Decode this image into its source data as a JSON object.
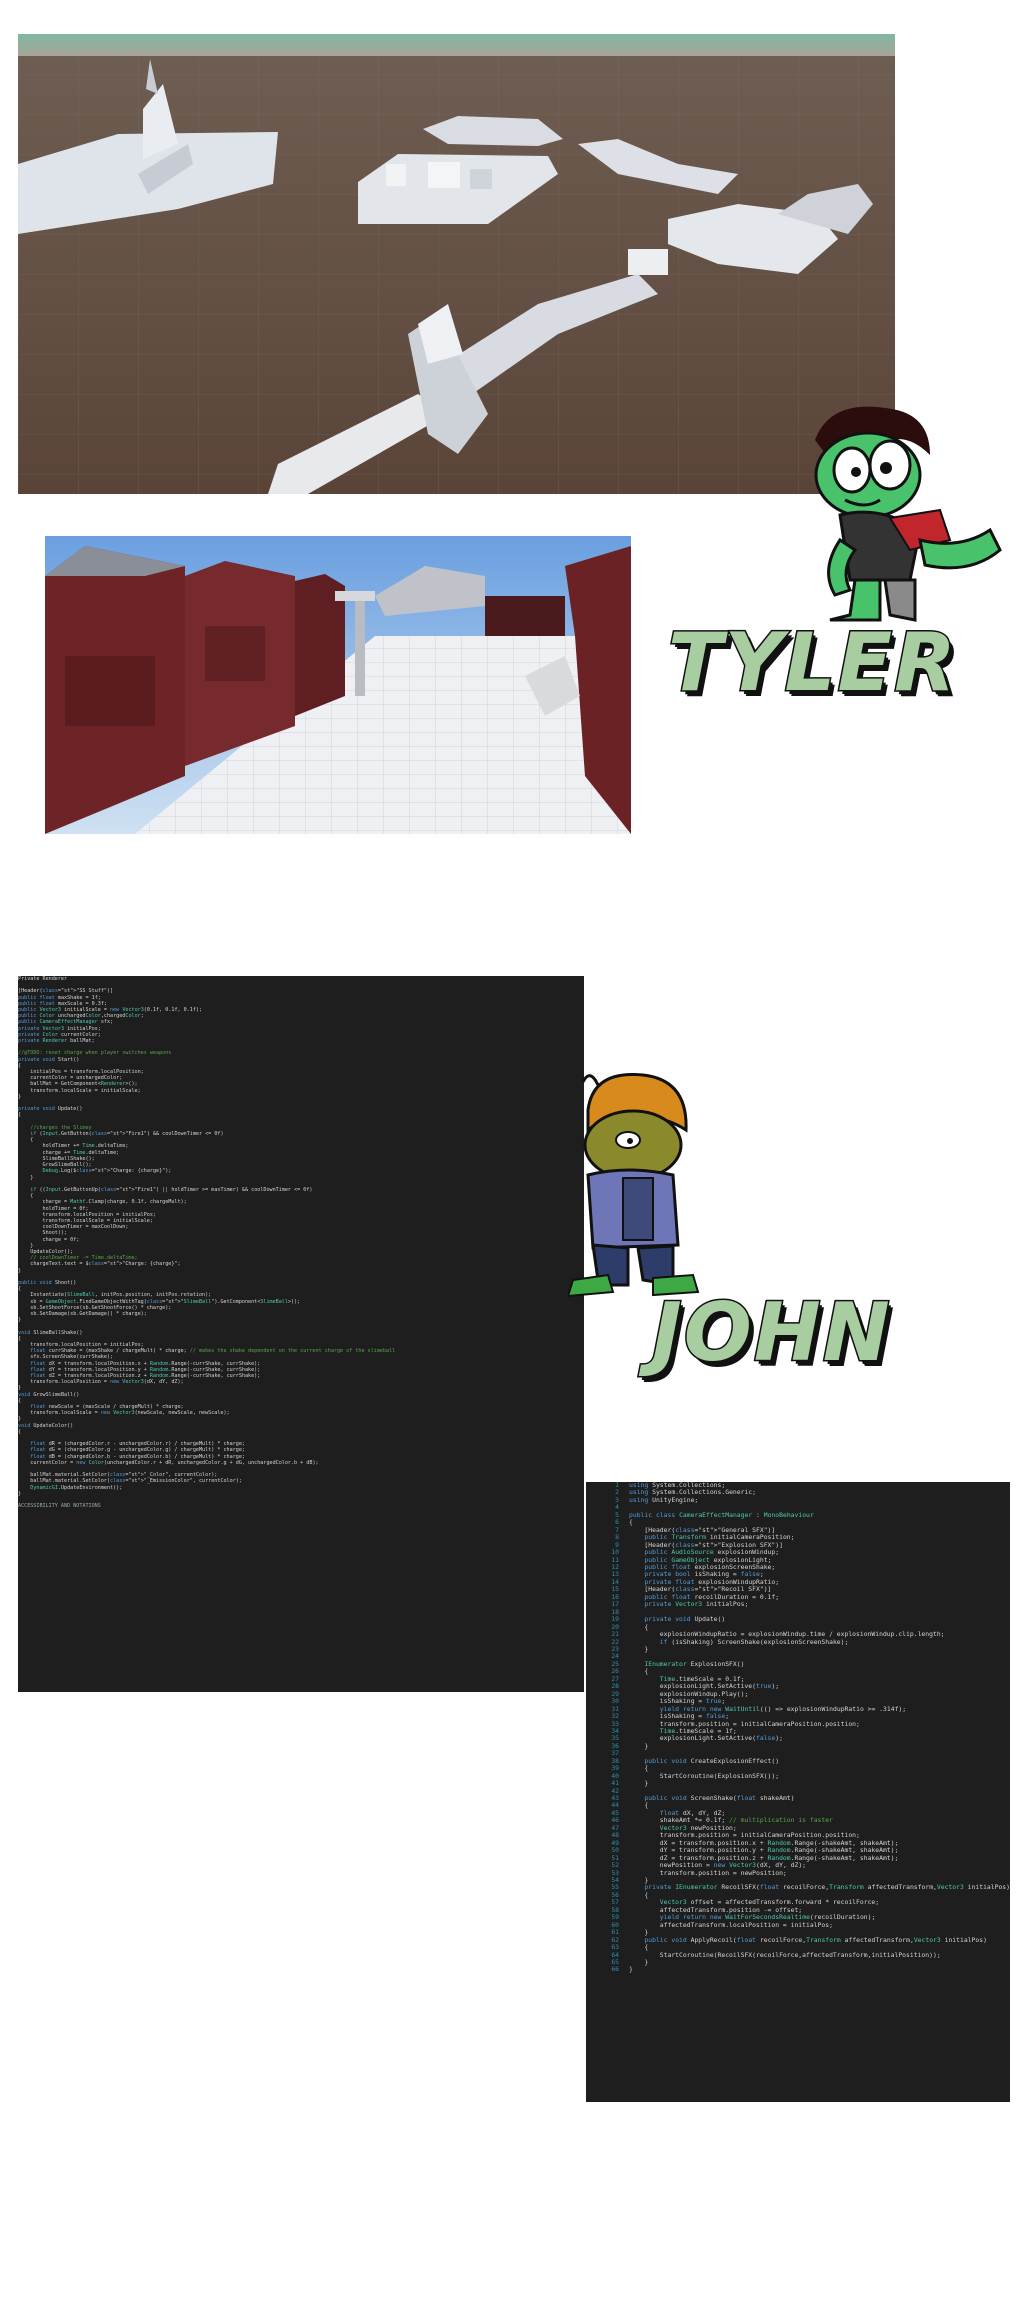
{
  "characters": [
    {
      "name": "TYLER"
    },
    {
      "name": "JOHN"
    }
  ],
  "code_left": {
    "top_fragment": "Private Renderer ",
    "lines": [
      "[Header(\"SS Stuff\")]",
      "public float maxShake = 1f;",
      "public float maxScale = 0.3f;",
      "public Vector3 initialScale = new Vector3(0.1f, 0.1f, 0.1f);",
      "public Color uncharged​Color,charged​Color;",
      "public CameraEffectManager sfx;",
      "private Vector3 initialPos;",
      "private Color currentColor;",
      "private Renderer ballMat;",
      "",
      "//@TODO: reset charge when player switches weapons",
      "private void Start()",
      "{",
      "    initialPos = transform.localPosition;",
      "    currentColor = unchargedColor;",
      "    ballMat = GetComponent<Renderer>();",
      "    transform.localScale = initialScale;",
      "}",
      "",
      "private void Update()",
      "{",
      "",
      "    //charges the Slimey",
      "    if (Input.GetButton(\"Fire1\") && coolDownTimer <= 0f)",
      "    {",
      "        holdTimer += Time.deltaTime;",
      "        charge += Time.deltaTime;",
      "        SlimeBallShake();",
      "        GrowSlimeBall();",
      "        Debug.Log($\"Charge: {charge}\");",
      "    }",
      "",
      "    if ((Input.GetButtonUp(\"Fire1\") || holdTimer >= maxTimer) && coolDownTimer <= 0f)",
      "    {",
      "        charge = Mathf.Clamp(charge, 0.1f, chargeMult);",
      "        holdTimer = 0f;",
      "        transform.localPosition = initialPos;",
      "        transform.localScale = initialScale;",
      "        coolDownTimer = maxCoolDown;",
      "        Shoot();",
      "        charge = 0f;",
      "    }",
      "    UpdateColor();",
      "    // coolDownTimer -= Time.deltaTime;",
      "    chargeText.text = $\"Charge: {charge}\";",
      "}",
      "",
      "public void Shoot()",
      "{",
      "    Instantiate(SlimeBall, initPos.position, initPos.rotation);",
      "    sb = GameObject.FindGameObjectWithTag(\"SlimeBall\").GetComponent<SlimeBall>();",
      "    sb.SetShootForce(sb.GetShootForce() * charge);",
      "    sb.SetDamage(sb.GetDamage() * charge);",
      "}",
      "",
      "void SlimeBallShake()",
      "{",
      "    transform.localPosition = initialPos;",
      "    float currShake = (maxShake / chargeMult) * charge; // makes the shake dependent on the current charge of the slimeball",
      "    sfx.ScreenShake(currShake);",
      "    float dX = transform.localPosition.x + Random.Range(-currShake, currShake);",
      "    float dY = transform.localPosition.y + Random.Range(-currShake, currShake);",
      "    float dZ = transform.localPosition.z + Random.Range(-currShake, currShake);",
      "    transform.localPosition = new Vector3(dX, dY, dZ);",
      "}",
      "void GrowSlimeBall()",
      "{",
      "    float newScale = (maxScale / chargeMult) * charge;",
      "    transform.localScale = new Vector3(newScale, newScale, newScale);",
      "}",
      "void UpdateColor()",
      "{",
      "",
      "    float dR = (chargedColor.r - unchargedColor.r) / chargeMult) * charge;",
      "    float dG = (chargedColor.g - unchargedColor.g) / chargeMult) * charge;",
      "    float dB = (chargedColor.b - unchargedColor.b) / chargeMult) * charge;",
      "    currentColor = new Color(unchargedColor.r + dR, unchargedColor.g + dG, unchargedColor.b + dB);",
      "",
      "    ballMat.material.SetColor(\"_Color\", currentColor);",
      "    ballMat.material.SetColor(\"_EmissionColor\", currentColor);",
      "    DynamicGI.UpdateEnvironment();",
      "}"
    ],
    "footer": "ACCESSIBILITY AND NOTATIONS"
  },
  "code_right": {
    "lines": [
      "using System.Collections;",
      "using System.Collections.Generic;",
      "using UnityEngine;",
      "",
      "public class CameraEffectManager : MonoBehaviour",
      "{",
      "    [Header(\"General SFX\")]",
      "    public Transform initialCameraPosition;",
      "    [Header(\"Explosion SFX\")]",
      "    public AudioSource explosionWindup;",
      "    public GameObject explosionLight;",
      "    public float explosionScreenShake;",
      "    private bool isShaking = false;",
      "    private float explosionWindupRatio;",
      "    [Header(\"Recoil SFX\")]",
      "    public float recoilDuration = 0.1f;",
      "    private Vector3 initialPos;",
      "",
      "    private void Update()",
      "    {",
      "        explosionWindupRatio = explosionWindup.time / explosionWindup.clip.length;",
      "        if (isShaking) ScreenShake(explosionScreenShake);",
      "    }",
      "",
      "    IEnumerator ExplosionSFX()",
      "    {",
      "        Time.timeScale = 0.1f;",
      "        explosionLight.SetActive(true);",
      "        explosionWindup.Play();",
      "        isShaking = true;",
      "        yield return new WaitUntil(() => explosionWindupRatio >= .314f);",
      "        isShaking = false;",
      "        transform.position = initialCameraPosition.position;",
      "        Time.timeScale = 1f;",
      "        explosionLight.SetActive(false);",
      "    }",
      "",
      "    public void CreateExplosionEffect()",
      "    {",
      "        StartCoroutine(ExplosionSFX());",
      "    }",
      "",
      "    public void ScreenShake(float shakeAmt)",
      "    {",
      "        float dX, dY, dZ;",
      "        shakeAmt *= 0.1f; // multiplication is faster",
      "        Vector3 newPosition;",
      "        transform.position = initialCameraPosition.position;",
      "        dX = transform.position.x + Random.Range(-shakeAmt, shakeAmt);",
      "        dY = transform.position.y + Random.Range(-shakeAmt, shakeAmt);",
      "        dZ = transform.position.z + Random.Range(-shakeAmt, shakeAmt);",
      "        newPosition = new Vector3(dX, dY, dZ);",
      "        transform.position = newPosition;",
      "    }",
      "    private IEnumerator RecoilSFX(float recoilForce,Transform affectedTransform,Vector3 initialPos)",
      "    {",
      "        Vector3 offset = affectedTransform.forward * recoilForce;",
      "        affectedTransform.position -= offset;",
      "        yield return new WaitForSecondsRealtime(recoilDuration);",
      "        affectedTransform.localPosition = initialPos;",
      "    }",
      "    public void ApplyRecoil(float recoilForce,Transform affectedTransform,Vector3 initialPos)",
      "    {",
      "        StartCoroutine(RecoilSFX(recoilForce,affectedTransform,initialPosition));",
      "    }",
      "}"
    ]
  }
}
